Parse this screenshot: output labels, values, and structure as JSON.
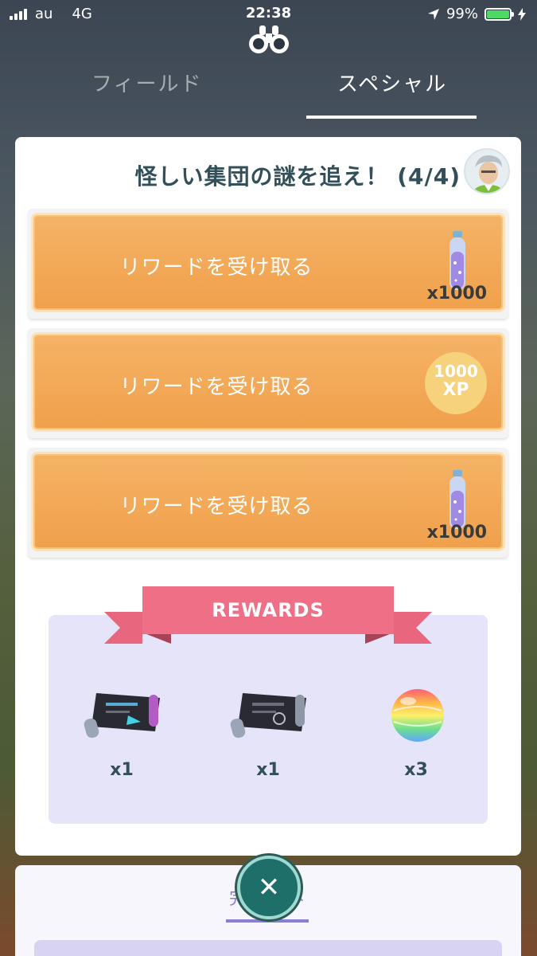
{
  "status_bar": {
    "carrier": "au",
    "network": "4G",
    "time": "22:38",
    "battery": "99%"
  },
  "tabs": {
    "field": "フィールド",
    "special": "スペシャル"
  },
  "research": {
    "title": "怪しい集団の謎を追え！ (4/4)"
  },
  "tasks": [
    {
      "label": "リワードを受け取る",
      "reward_icon": "stardust-icon",
      "quantity": "x1000"
    },
    {
      "label": "リワードを受け取る",
      "reward_icon": "xp-badge",
      "xp_amount": "1000",
      "xp_unit": "XP"
    },
    {
      "label": "リワードを受け取る",
      "reward_icon": "stardust-icon",
      "quantity": "x1000"
    }
  ],
  "rewards": {
    "title": "REWARDS",
    "items": [
      {
        "icon": "tm-scroll-icon",
        "quantity": "x1"
      },
      {
        "icon": "tm-scroll-icon",
        "quantity": "x1"
      },
      {
        "icon": "rare-candy-icon",
        "quantity": "x3"
      }
    ]
  },
  "bottom": {
    "completed_tab": "完了済み"
  },
  "colors": {
    "accent_orange": "#f0a04b",
    "ribbon_pink": "#ee6f86",
    "rewards_bg": "#e6e4f9",
    "title_text": "#33505a"
  }
}
